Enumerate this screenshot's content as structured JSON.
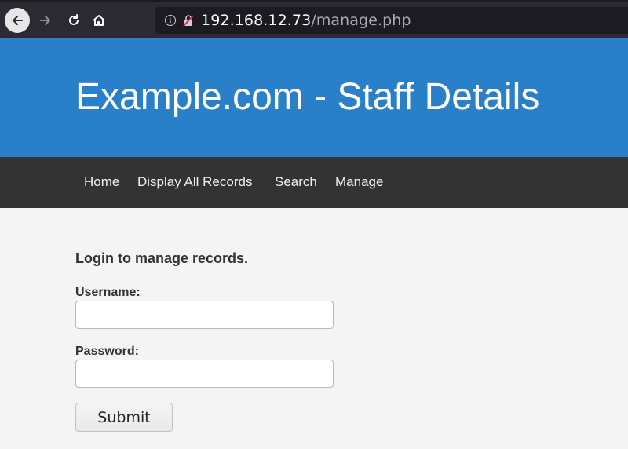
{
  "browser": {
    "url_host": "192.168.12.73",
    "url_path": "/manage.php",
    "icons": [
      "back-arrow-icon",
      "forward-arrow-icon",
      "reload-icon",
      "home-icon",
      "info-icon",
      "insecure-lock-icon"
    ],
    "colors": {
      "toolbar_bg": "#2b2a33",
      "urlbar_bg": "#1c1b22"
    }
  },
  "site": {
    "title": "Example.com - Staff Details",
    "colors": {
      "header_bg": "#2a80c8",
      "nav_bg": "#333333",
      "page_bg": "#f4f4f4"
    }
  },
  "nav": {
    "items": [
      {
        "label": "Home"
      },
      {
        "label": "Display All Records"
      },
      {
        "label": "Search"
      },
      {
        "label": "Manage"
      }
    ]
  },
  "login": {
    "heading": "Login to manage records.",
    "username_label": "Username:",
    "username_value": "",
    "password_label": "Password:",
    "password_value": "",
    "submit_label": "Submit"
  }
}
